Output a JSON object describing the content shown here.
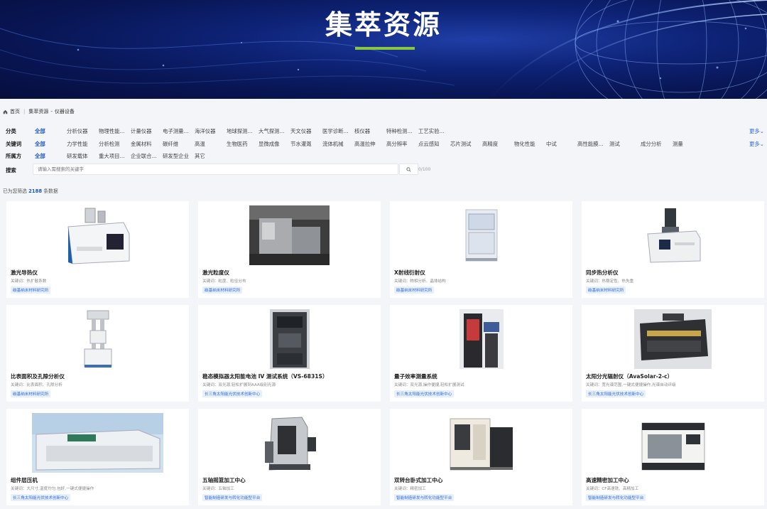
{
  "banner": {
    "title": "集萃资源"
  },
  "breadcrumb": {
    "home": "首页",
    "level1": "集萃资源",
    "level2": "仪器设备"
  },
  "filters": {
    "category": {
      "label": "分类",
      "items": [
        "全部",
        "分析仪器",
        "物理性能...",
        "计量仪器",
        "电子测量...",
        "海洋仪器",
        "地球探测...",
        "大气探测...",
        "天文仪器",
        "医学诊断...",
        "核仪器",
        "特种检测...",
        "工艺实验..."
      ],
      "more": "更多"
    },
    "keyword": {
      "label": "关键词",
      "items": [
        "全部",
        "力学性能",
        "分析检测",
        "金属材料",
        "碳纤维",
        "高温",
        "生物医药",
        "显微成像",
        "节水灌溉",
        "流体机械",
        "高温拉伸",
        "高分辨率",
        "点云感知",
        "芯片测试",
        "高精度",
        "物化性能",
        "中试",
        "高性能膜...",
        "测试",
        "成分分析",
        "测量"
      ],
      "more": "更多"
    },
    "owner": {
      "label": "所属方",
      "items": [
        "全部",
        "研发载体",
        "重大项目...",
        "企业联合...",
        "研发型企业",
        "其它"
      ]
    },
    "search": {
      "label": "搜索",
      "placeholder": "请输入需搜索的关键字",
      "count": "0/100"
    }
  },
  "result": {
    "prefix": "已为您筛选",
    "count": "2188",
    "suffix": "条数据"
  },
  "cards": [
    {
      "title": "激光导热仪",
      "keywords": "关键词：热扩散系数",
      "tag": "碳基纳米材料研究所"
    },
    {
      "title": "激光粒度仪",
      "keywords": "关键词：粒度、粒径分布",
      "tag": "碳基纳米材料研究所"
    },
    {
      "title": "X射线衍射仪",
      "keywords": "关键词：物相分析、晶体结构",
      "tag": "碳基纳米材料研究所"
    },
    {
      "title": "同步热分析仪",
      "keywords": "关键词：热稳定性、热失重",
      "tag": "碳基纳米材料研究所"
    },
    {
      "title": "比表面积及孔隙分析仪",
      "keywords": "关键词：比表面积、孔隙分析",
      "tag": "碳基纳米材料研究所"
    },
    {
      "title": "稳态模拟器太阳能电池 IV 测试系统（VS-6831S）",
      "keywords": "关键词：双光源,轻松扩展到AAA级别光源",
      "tag": "长三角太阳能光伏技术创新中心"
    },
    {
      "title": "量子效率测量系统",
      "keywords": "关键词：双光源,操作便捷,轻松扩展测试",
      "tag": "长三角太阳能光伏技术创新中心"
    },
    {
      "title": "太阳分光辐射仪（AvaSolar-2-c）",
      "keywords": "关键词：宽光谱范围,一键式便捷操作,光谱自动评级",
      "tag": "长三角太阳能光伏技术创新中心"
    },
    {
      "title": "组件层压机",
      "keywords": "关键词：大尺寸,温度均匀,包好,一键式便捷操作",
      "tag": "长三角太阳能光伏技术创新中心"
    },
    {
      "title": "五轴摇篮加工中心",
      "keywords": "关键词：五轴加工",
      "tag": "智能制造研发与转化功能型平台"
    },
    {
      "title": "双转台卧式加工中心",
      "keywords": "关键词：精密加工",
      "tag": "智能制造研发与转化功能型平台"
    },
    {
      "title": "高速精密加工中心",
      "keywords": "关键词：CF高速铣、高精加工",
      "tag": "智能制造研发与转化功能型平台"
    }
  ]
}
